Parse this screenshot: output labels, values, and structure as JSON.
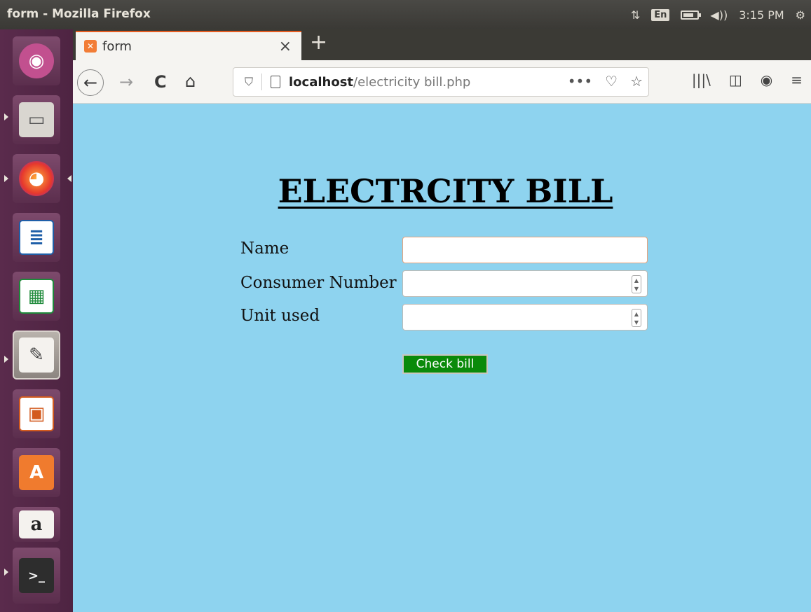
{
  "system_panel": {
    "window_title": "form - Mozilla Firefox",
    "network_icon": "network-arrows-icon",
    "keyboard_layout": "En",
    "battery_icon": "battery-icon",
    "volume_icon": "volume-icon",
    "time": "3:15 PM",
    "power_icon": "power-gear-icon"
  },
  "launcher": {
    "items": [
      {
        "name": "ubuntu-dash",
        "glyph": "◉"
      },
      {
        "name": "files",
        "glyph": "▭"
      },
      {
        "name": "firefox",
        "glyph": "◕"
      },
      {
        "name": "libreoffice-writer",
        "glyph": "≣"
      },
      {
        "name": "libreoffice-calc",
        "glyph": "▦"
      },
      {
        "name": "text-editor",
        "glyph": "✎"
      },
      {
        "name": "libreoffice-impress",
        "glyph": "▣"
      },
      {
        "name": "software-center",
        "glyph": "A"
      },
      {
        "name": "amazon",
        "glyph": "a"
      },
      {
        "name": "terminal",
        "glyph": ">_"
      }
    ]
  },
  "browser": {
    "tab": {
      "title": "form",
      "close_glyph": "×"
    },
    "new_tab_glyph": "+",
    "nav": {
      "back": "←",
      "forward": "→",
      "reload": "C",
      "home": "⌂"
    },
    "url": {
      "host": "localhost",
      "path": "/electricity bill.php"
    },
    "url_actions": {
      "more": "•••",
      "pocket": "♡",
      "bookmark": "☆"
    },
    "tools": {
      "library": "|||\\",
      "sidebar": "◫",
      "account": "◉",
      "menu": "≡"
    }
  },
  "page": {
    "heading": "ELECTRCITY BILL",
    "form": {
      "name_label": "Name",
      "name_value": "",
      "consumer_label": "Consumer Number",
      "consumer_value": "",
      "unit_label": "Unit used",
      "unit_value": "",
      "submit_label": "Check bill"
    }
  },
  "colors": {
    "page_background": "#8ed3ef",
    "button_green": "#0a8a0a",
    "launcher_purple": "#5a2b4c",
    "tab_accent": "#e45c21"
  }
}
